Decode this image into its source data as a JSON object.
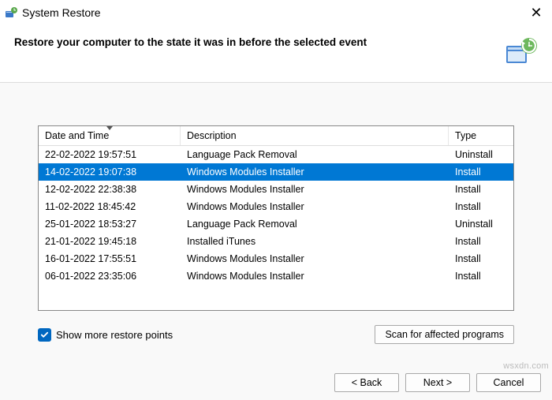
{
  "window": {
    "title": "System Restore",
    "close": "✕"
  },
  "header": {
    "heading": "Restore your computer to the state it was in before the selected event"
  },
  "table": {
    "columns": {
      "date": "Date and Time",
      "desc": "Description",
      "type": "Type"
    },
    "rows": [
      {
        "date": "22-02-2022 19:57:51",
        "desc": "Language Pack Removal",
        "type": "Uninstall",
        "selected": false
      },
      {
        "date": "14-02-2022 19:07:38",
        "desc": "Windows Modules Installer",
        "type": "Install",
        "selected": true
      },
      {
        "date": "12-02-2022 22:38:38",
        "desc": "Windows Modules Installer",
        "type": "Install",
        "selected": false
      },
      {
        "date": "11-02-2022 18:45:42",
        "desc": "Windows Modules Installer",
        "type": "Install",
        "selected": false
      },
      {
        "date": "25-01-2022 18:53:27",
        "desc": "Language Pack Removal",
        "type": "Uninstall",
        "selected": false
      },
      {
        "date": "21-01-2022 19:45:18",
        "desc": "Installed iTunes",
        "type": "Install",
        "selected": false
      },
      {
        "date": "16-01-2022 17:55:51",
        "desc": "Windows Modules Installer",
        "type": "Install",
        "selected": false
      },
      {
        "date": "06-01-2022 23:35:06",
        "desc": "Windows Modules Installer",
        "type": "Install",
        "selected": false
      }
    ]
  },
  "options": {
    "show_more_label": "Show more restore points",
    "show_more_checked": true,
    "scan_button": "Scan for affected programs"
  },
  "footer": {
    "back": "< Back",
    "next": "Next >",
    "cancel": "Cancel"
  },
  "watermark": "wsxdn.com"
}
